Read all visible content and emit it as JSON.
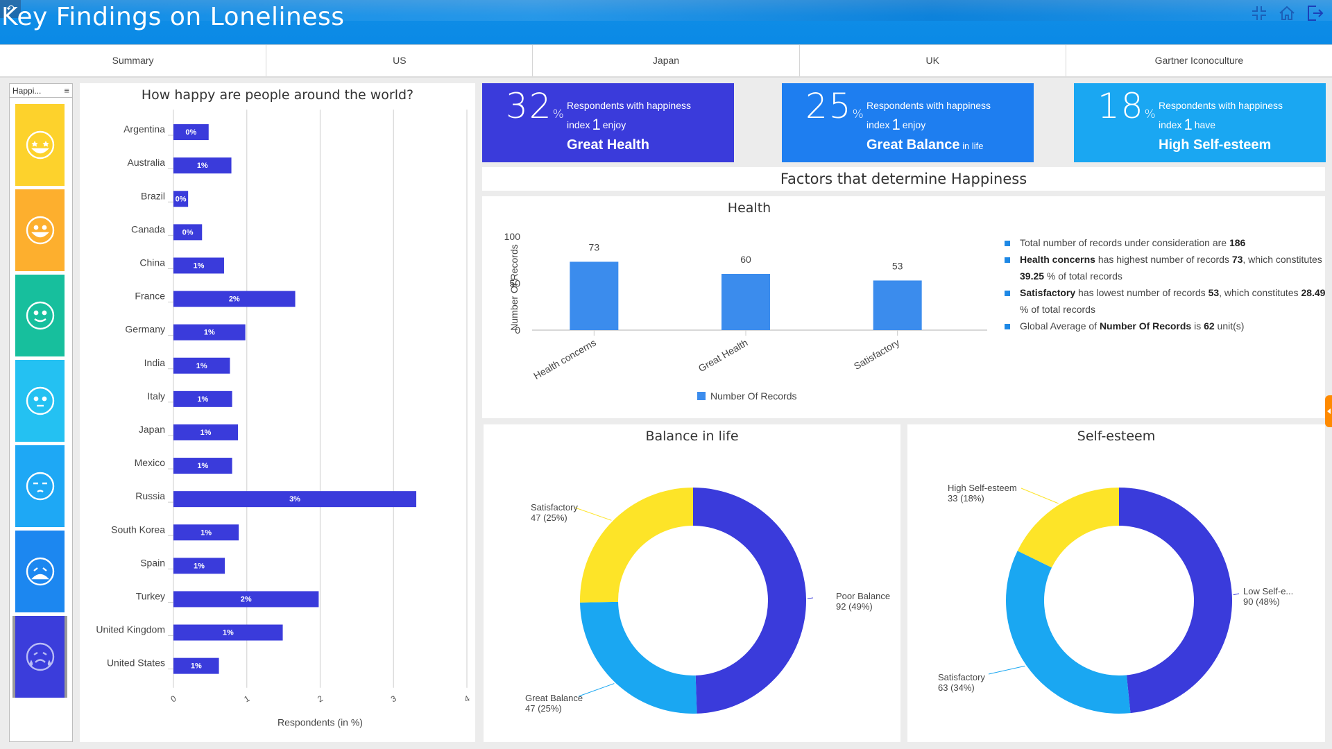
{
  "header": {
    "title": "Key Findings on Loneliness",
    "icons": [
      "back-arrow-icon",
      "collapse-icon",
      "home-icon",
      "logout-icon"
    ]
  },
  "tabs": [
    {
      "label": "Summary"
    },
    {
      "label": "US"
    },
    {
      "label": "Japan"
    },
    {
      "label": "UK"
    },
    {
      "label": "Gartner Iconoculture"
    }
  ],
  "sidebar": {
    "title": "Happi...",
    "menu_icon": "hamburger-icon",
    "items": [
      {
        "icon": "star-eyes-face-icon",
        "color": "#fdd22c",
        "level": 1
      },
      {
        "icon": "grin-face-icon",
        "color": "#fdaf2e",
        "level": 2
      },
      {
        "icon": "smile-face-icon",
        "color": "#17bf9d",
        "level": 3
      },
      {
        "icon": "neutral-face-icon",
        "color": "#24c1f2",
        "level": 4
      },
      {
        "icon": "unamused-face-icon",
        "color": "#1ea8f5",
        "level": 5
      },
      {
        "icon": "sad-face-icon",
        "color": "#1c87f0",
        "level": 6
      },
      {
        "icon": "crying-face-icon",
        "color": "#3b3ddb",
        "level": 7,
        "selected": true
      }
    ]
  },
  "kpis": [
    {
      "value": "32",
      "unit": "%",
      "line1": "Respondents with happiness",
      "line2_pre": "index",
      "index": "1",
      "line2_post": "enjoy",
      "headline": "Great Health",
      "suffix": "",
      "color": "#3a3bdb"
    },
    {
      "value": "25",
      "unit": "%",
      "line1": "Respondents with happiness",
      "line2_pre": "index",
      "index": "1",
      "line2_post": "enjoy",
      "headline": "Great Balance",
      "suffix": " in life",
      "color": "#1e7ef0"
    },
    {
      "value": "18",
      "unit": "%",
      "line1": "Respondents with happiness",
      "line2_pre": "index",
      "index": "1",
      "line2_post": "have",
      "headline": "High Self-esteem",
      "suffix": "",
      "color": "#1aa7f2"
    }
  ],
  "factors_title": "Factors that determine Happiness",
  "insights": [
    {
      "parts": [
        {
          "t": "Total number of records under consideration are "
        },
        {
          "t": "186",
          "b": true
        }
      ]
    },
    {
      "parts": [
        {
          "t": "Health concerns",
          "b": true
        },
        {
          "t": " has highest number of records "
        },
        {
          "t": "73",
          "b": true
        },
        {
          "t": ", which constitutes "
        },
        {
          "t": "39.25",
          "b": true
        },
        {
          "t": " % of total records"
        }
      ]
    },
    {
      "parts": [
        {
          "t": "Satisfactory",
          "b": true
        },
        {
          "t": " has lowest number of records "
        },
        {
          "t": "53",
          "b": true
        },
        {
          "t": ", which constitutes "
        },
        {
          "t": "28.49",
          "b": true
        },
        {
          "t": " % of total records"
        }
      ]
    },
    {
      "parts": [
        {
          "t": "Global Average of "
        },
        {
          "t": "Number Of Records",
          "b": true
        },
        {
          "t": " is "
        },
        {
          "t": "62",
          "b": true
        },
        {
          "t": " unit(s)"
        }
      ]
    }
  ],
  "chart_data": [
    {
      "id": "world",
      "type": "bar",
      "orientation": "horizontal",
      "title": "How happy are people around the world?",
      "xlabel": "Respondents (in %)",
      "ylabel": "",
      "xlim": [
        0,
        4
      ],
      "xticks": [
        "0",
        "1",
        "2",
        "3",
        "4"
      ],
      "grid": true,
      "color": "#3a3bdb",
      "categories": [
        "Argentina",
        "Australia",
        "Brazil",
        "Canada",
        "China",
        "France",
        "Germany",
        "India",
        "Italy",
        "Japan",
        "Mexico",
        "Russia",
        "South Korea",
        "Spain",
        "Turkey",
        "United Kingdom",
        "United States"
      ],
      "values": [
        0.48,
        0.79,
        0.2,
        0.39,
        0.69,
        1.66,
        0.98,
        0.77,
        0.8,
        0.88,
        0.8,
        3.31,
        0.89,
        0.7,
        1.98,
        1.49,
        0.62
      ],
      "data_labels": [
        "0%",
        "1%",
        "0%",
        "0%",
        "1%",
        "2%",
        "1%",
        "1%",
        "1%",
        "1%",
        "1%",
        "3%",
        "1%",
        "1%",
        "2%",
        "1%",
        "1%"
      ]
    },
    {
      "id": "health",
      "type": "bar",
      "title": "Health",
      "xlabel": "",
      "ylabel": "Number Of Records",
      "ylim": [
        0,
        100
      ],
      "yticks": [
        "0",
        "50",
        "100"
      ],
      "grid": false,
      "color": "#3b8ced",
      "categories": [
        "Health concerns",
        "Great Health",
        "Satisfactory"
      ],
      "series": [
        {
          "name": "Number Of Records",
          "values": [
            73,
            60,
            53
          ]
        }
      ],
      "legend": "bottom"
    },
    {
      "id": "balance",
      "type": "pie",
      "donut": true,
      "title": "Balance in life",
      "slices": [
        {
          "label": "Poor Balance",
          "value": 92,
          "pct": "49%",
          "color": "#3a3bdb"
        },
        {
          "label": "Great Balance",
          "value": 47,
          "pct": "25%",
          "color": "#1aa7f2"
        },
        {
          "label": "Satisfactory",
          "value": 47,
          "pct": "25%",
          "color": "#fde428"
        }
      ]
    },
    {
      "id": "selfesteem",
      "type": "pie",
      "donut": true,
      "title": "Self-esteem",
      "slices": [
        {
          "label": "Low Self-e...",
          "value": 90,
          "pct": "48%",
          "color": "#3a3bdb"
        },
        {
          "label": "Satisfactory",
          "value": 63,
          "pct": "34%",
          "color": "#1aa7f2"
        },
        {
          "label": "High Self-esteem",
          "value": 33,
          "pct": "18%",
          "color": "#fde428"
        }
      ]
    }
  ]
}
